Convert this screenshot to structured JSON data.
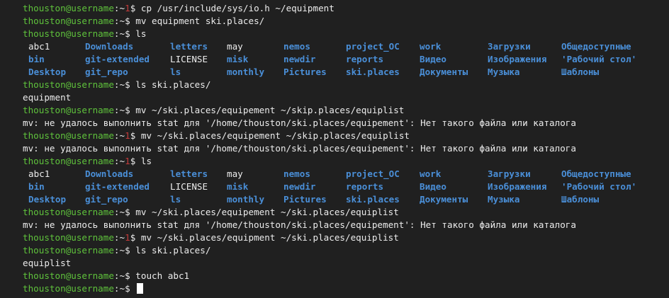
{
  "prompt": {
    "user": "thouston@username",
    "colon": ":",
    "tilde": "~",
    "dollar": "$"
  },
  "lines": [
    {
      "type": "prompt",
      "badge": "1",
      "cmd": "cp /usr/include/sys/io.h ~/equipment"
    },
    {
      "type": "prompt",
      "badge": "",
      "cmd": "mv equipment ski.places/"
    },
    {
      "type": "prompt",
      "badge": "",
      "cmd": "ls"
    },
    {
      "type": "ls",
      "cells": [
        {
          "text": "abc1",
          "kind": "file"
        },
        {
          "text": "Downloads",
          "kind": "dir"
        },
        {
          "text": "letters",
          "kind": "dir"
        },
        {
          "text": "may",
          "kind": "file"
        },
        {
          "text": "nemos",
          "kind": "dir"
        },
        {
          "text": "project_OC",
          "kind": "dir"
        },
        {
          "text": "work",
          "kind": "dir"
        },
        {
          "text": "Загрузки",
          "kind": "dir"
        },
        {
          "text": "Общедоступные",
          "kind": "dir"
        }
      ]
    },
    {
      "type": "ls",
      "cells": [
        {
          "text": "bin",
          "kind": "dir"
        },
        {
          "text": "git-extended",
          "kind": "dir"
        },
        {
          "text": "LICENSE",
          "kind": "file"
        },
        {
          "text": "misk",
          "kind": "dir"
        },
        {
          "text": "newdir",
          "kind": "dir"
        },
        {
          "text": "reports",
          "kind": "dir"
        },
        {
          "text": "Видео",
          "kind": "dir"
        },
        {
          "text": "Изображения",
          "kind": "dir"
        },
        {
          "text": "'Рабочий стол'",
          "kind": "dir"
        }
      ]
    },
    {
      "type": "ls",
      "cells": [
        {
          "text": "Desktop",
          "kind": "dir"
        },
        {
          "text": "git_repo",
          "kind": "dir"
        },
        {
          "text": "ls",
          "kind": "dir"
        },
        {
          "text": "monthly",
          "kind": "dir"
        },
        {
          "text": "Pictures",
          "kind": "dir"
        },
        {
          "text": "ski.places",
          "kind": "dir"
        },
        {
          "text": "Документы",
          "kind": "dir"
        },
        {
          "text": "Музыка",
          "kind": "dir"
        },
        {
          "text": "Шаблоны",
          "kind": "dir"
        }
      ]
    },
    {
      "type": "prompt",
      "badge": "",
      "cmd": "ls ski.places/"
    },
    {
      "type": "output",
      "text": "equipment"
    },
    {
      "type": "prompt",
      "badge": "",
      "cmd": "mv ~/ski.places/equipement ~/skip.places/equiplist"
    },
    {
      "type": "output",
      "text": "mv: не удалось выполнить stat для '/home/thouston/ski.places/equipement': Нет такого файла или каталога"
    },
    {
      "type": "prompt",
      "badge": "1",
      "cmd": "mv ~/ski.places/equipement ~/skip.places/equiplist"
    },
    {
      "type": "output",
      "text": "mv: не удалось выполнить stat для '/home/thouston/ski.places/equipement': Нет такого файла или каталога"
    },
    {
      "type": "prompt",
      "badge": "1",
      "cmd": "ls"
    },
    {
      "type": "ls",
      "cells": [
        {
          "text": "abc1",
          "kind": "file"
        },
        {
          "text": "Downloads",
          "kind": "dir"
        },
        {
          "text": "letters",
          "kind": "dir"
        },
        {
          "text": "may",
          "kind": "file"
        },
        {
          "text": "nemos",
          "kind": "dir"
        },
        {
          "text": "project_OC",
          "kind": "dir"
        },
        {
          "text": "work",
          "kind": "dir"
        },
        {
          "text": "Загрузки",
          "kind": "dir"
        },
        {
          "text": "Общедоступные",
          "kind": "dir"
        }
      ]
    },
    {
      "type": "ls",
      "cells": [
        {
          "text": "bin",
          "kind": "dir"
        },
        {
          "text": "git-extended",
          "kind": "dir"
        },
        {
          "text": "LICENSE",
          "kind": "file"
        },
        {
          "text": "misk",
          "kind": "dir"
        },
        {
          "text": "newdir",
          "kind": "dir"
        },
        {
          "text": "reports",
          "kind": "dir"
        },
        {
          "text": "Видео",
          "kind": "dir"
        },
        {
          "text": "Изображения",
          "kind": "dir"
        },
        {
          "text": "'Рабочий стол'",
          "kind": "dir"
        }
      ]
    },
    {
      "type": "ls",
      "cells": [
        {
          "text": "Desktop",
          "kind": "dir"
        },
        {
          "text": "git_repo",
          "kind": "dir"
        },
        {
          "text": "ls",
          "kind": "dir"
        },
        {
          "text": "monthly",
          "kind": "dir"
        },
        {
          "text": "Pictures",
          "kind": "dir"
        },
        {
          "text": "ski.places",
          "kind": "dir"
        },
        {
          "text": "Документы",
          "kind": "dir"
        },
        {
          "text": "Музыка",
          "kind": "dir"
        },
        {
          "text": "Шаблоны",
          "kind": "dir"
        }
      ]
    },
    {
      "type": "prompt",
      "badge": "",
      "cmd": "mv ~/ski.places/equipement ~/ski.places/equiplist"
    },
    {
      "type": "output",
      "text": "mv: не удалось выполнить stat для '/home/thouston/ski.places/equipement': Нет такого файла или каталога"
    },
    {
      "type": "prompt",
      "badge": "1",
      "cmd": "mv ~/ski.places/equipment ~/ski.places/equiplist"
    },
    {
      "type": "prompt",
      "badge": "",
      "cmd": "ls ski.places/"
    },
    {
      "type": "output",
      "text": "equiplist"
    },
    {
      "type": "prompt",
      "badge": "",
      "cmd": "touch abc1"
    },
    {
      "type": "prompt",
      "badge": "",
      "cmd": "",
      "cursor": true
    }
  ],
  "colors": {
    "background": "#202020",
    "prompt_user": "#5fc33c",
    "error_badge": "#c23a3a",
    "directory": "#4a8fd8",
    "text": "#ececec"
  }
}
